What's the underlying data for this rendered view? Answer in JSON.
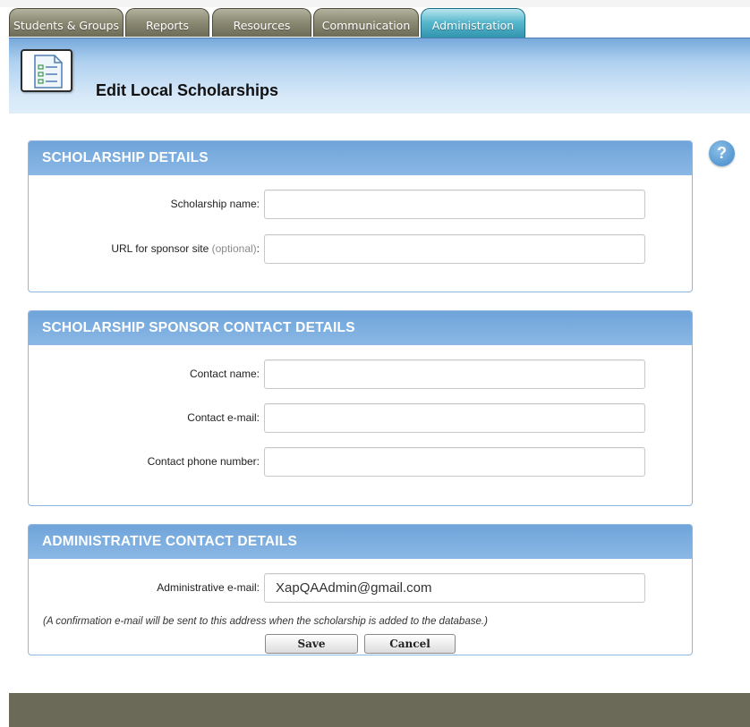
{
  "tabs": [
    {
      "label": "Students & Groups"
    },
    {
      "label": "Reports"
    },
    {
      "label": "Resources"
    },
    {
      "label": "Communication"
    },
    {
      "label": "Administration",
      "active": true
    }
  ],
  "header": {
    "title": "Edit Local Scholarships",
    "icon": "checklist-document-icon"
  },
  "help": {
    "glyph": "?"
  },
  "sections": {
    "scholarship_details": {
      "title": "SCHOLARSHIP DETAILS",
      "fields": {
        "scholarship_name": {
          "label": "Scholarship name:",
          "value": ""
        },
        "sponsor_url": {
          "label": "URL for sponsor site",
          "optional": "(optional)",
          "colon": ":",
          "value": ""
        }
      }
    },
    "sponsor_contact": {
      "title": "SCHOLARSHIP SPONSOR CONTACT DETAILS",
      "fields": {
        "contact_name": {
          "label": "Contact name:",
          "value": ""
        },
        "contact_email": {
          "label": "Contact e-mail:",
          "value": ""
        },
        "contact_phone": {
          "label": "Contact phone number:",
          "value": ""
        }
      }
    },
    "admin_contact": {
      "title": "ADMINISTRATIVE CONTACT DETAILS",
      "fields": {
        "admin_email": {
          "label": "Administrative e-mail:",
          "value": "XapQAAdmin@gmail.com"
        }
      },
      "note": "(A confirmation e-mail will be sent to this address when the scholarship is added to the database.)"
    }
  },
  "buttons": {
    "save": "Save",
    "cancel": "Cancel"
  },
  "colors": {
    "tab_active": "#2f93ad",
    "tab_inactive": "#8c8b74",
    "section_header": "#7aaddf",
    "chrome": "#6b6a59"
  }
}
